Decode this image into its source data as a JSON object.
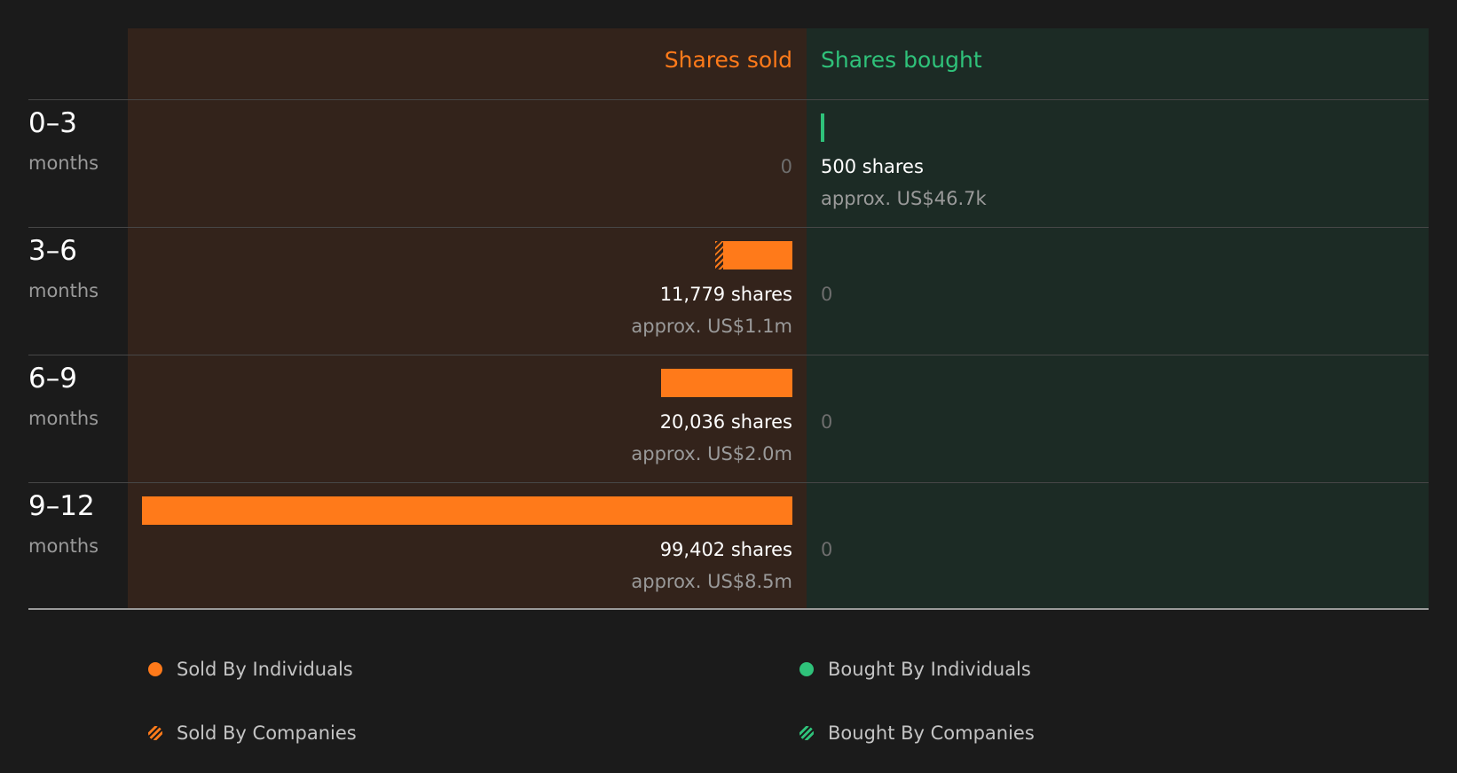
{
  "chart_data": {
    "type": "bar",
    "headers": {
      "sold": "Shares sold",
      "bought": "Shares bought"
    },
    "periods": [
      {
        "range": "0–3",
        "unit": "months",
        "sold": {
          "individuals": 0,
          "companies": 0,
          "label": "0",
          "approx": ""
        },
        "bought": {
          "individuals": 500,
          "companies": 0,
          "label": "500 shares",
          "approx": "approx. US$46.7k"
        }
      },
      {
        "range": "3–6",
        "unit": "months",
        "sold": {
          "individuals": 10600,
          "companies": 1179,
          "label": "11,779 shares",
          "approx": "approx. US$1.1m"
        },
        "bought": {
          "individuals": 0,
          "companies": 0,
          "label": "0",
          "approx": ""
        }
      },
      {
        "range": "6–9",
        "unit": "months",
        "sold": {
          "individuals": 20036,
          "companies": 0,
          "label": "20,036 shares",
          "approx": "approx. US$2.0m"
        },
        "bought": {
          "individuals": 0,
          "companies": 0,
          "label": "0",
          "approx": ""
        }
      },
      {
        "range": "9–12",
        "unit": "months",
        "sold": {
          "individuals": 99402,
          "companies": 0,
          "label": "99,402 shares",
          "approx": "approx. US$8.5m"
        },
        "bought": {
          "individuals": 0,
          "companies": 0,
          "label": "0",
          "approx": ""
        }
      }
    ],
    "max_value": 99402,
    "legend": [
      {
        "label": "Sold By Individuals",
        "style": "solid-orange"
      },
      {
        "label": "Bought By Individuals",
        "style": "solid-green"
      },
      {
        "label": "Sold By Companies",
        "style": "hatch-orange"
      },
      {
        "label": "Bought By Companies",
        "style": "hatch-green"
      }
    ]
  },
  "colors": {
    "sold": "#ff7a1a",
    "bought": "#2fc27a",
    "sold_bg": "#33231b",
    "bought_bg": "#1c2b25",
    "page_bg": "#1b1b1b"
  }
}
